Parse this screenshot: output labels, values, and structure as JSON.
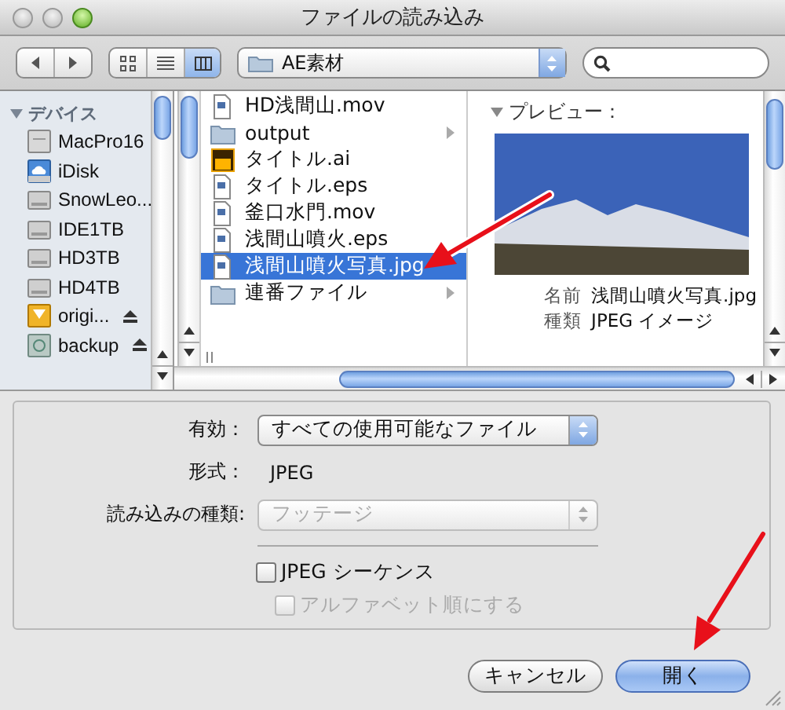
{
  "window": {
    "title": "ファイルの読み込み"
  },
  "toolbar": {
    "nav_buttons": [
      {
        "kind": "back"
      },
      {
        "kind": "forward"
      }
    ],
    "view_modes": [
      {
        "kind": "icon",
        "selected": false
      },
      {
        "kind": "list",
        "selected": false
      },
      {
        "kind": "column",
        "selected": true
      }
    ],
    "location": "AE素材"
  },
  "sidebar": {
    "title": "デバイス",
    "expanded": true,
    "items": [
      {
        "label": "MacPro16",
        "kind": "computer",
        "eject": false
      },
      {
        "label": "iDisk",
        "kind": "idisk",
        "eject": false
      },
      {
        "label": "SnowLeo...",
        "kind": "drive",
        "eject": false
      },
      {
        "label": "IDE1TB",
        "kind": "drive",
        "eject": false
      },
      {
        "label": "HD3TB",
        "kind": "drive",
        "eject": false
      },
      {
        "label": "HD4TB",
        "kind": "drive",
        "eject": false
      },
      {
        "label": "origi...",
        "kind": "volume",
        "eject": true
      },
      {
        "label": "backup",
        "kind": "disk-image",
        "eject": true
      }
    ]
  },
  "files": [
    {
      "name": "HD浅間山.mov",
      "kind": "document",
      "selected": false
    },
    {
      "name": "output",
      "kind": "folder",
      "selected": false
    },
    {
      "name": "タイトル.ai",
      "kind": "ai",
      "selected": false
    },
    {
      "name": "タイトル.eps",
      "kind": "document",
      "selected": false
    },
    {
      "name": "釜口水門.mov",
      "kind": "document",
      "selected": false
    },
    {
      "name": "浅間山噴火.eps",
      "kind": "document",
      "selected": false
    },
    {
      "name": "浅間山噴火写真.jpg",
      "kind": "document",
      "selected": true
    },
    {
      "name": "連番ファイル",
      "kind": "folder",
      "selected": false
    }
  ],
  "preview": {
    "title": "プレビュー：",
    "expanded": true,
    "info": [
      {
        "label": "名前",
        "value": "浅間山噴火写真.jpg"
      },
      {
        "label": "種類",
        "value": "JPEG イメージ"
      }
    ]
  },
  "options": {
    "fields": [
      {
        "kind": "popup",
        "label": "有効：",
        "value": "すべての使用可能なファイル",
        "disabled": false
      },
      {
        "kind": "text",
        "label": "形式：",
        "value": "JPEG"
      },
      {
        "kind": "popup",
        "label": "読み込みの種類:",
        "value": "フッテージ",
        "disabled": true
      }
    ],
    "checkboxes": [
      {
        "label": "JPEG シーケンス",
        "checked": false,
        "disabled": false
      },
      {
        "label": "アルファベット順にする",
        "checked": false,
        "disabled": true
      }
    ]
  },
  "buttons": [
    {
      "label": "キャンセル",
      "default": false
    },
    {
      "label": "開く",
      "default": true
    }
  ]
}
